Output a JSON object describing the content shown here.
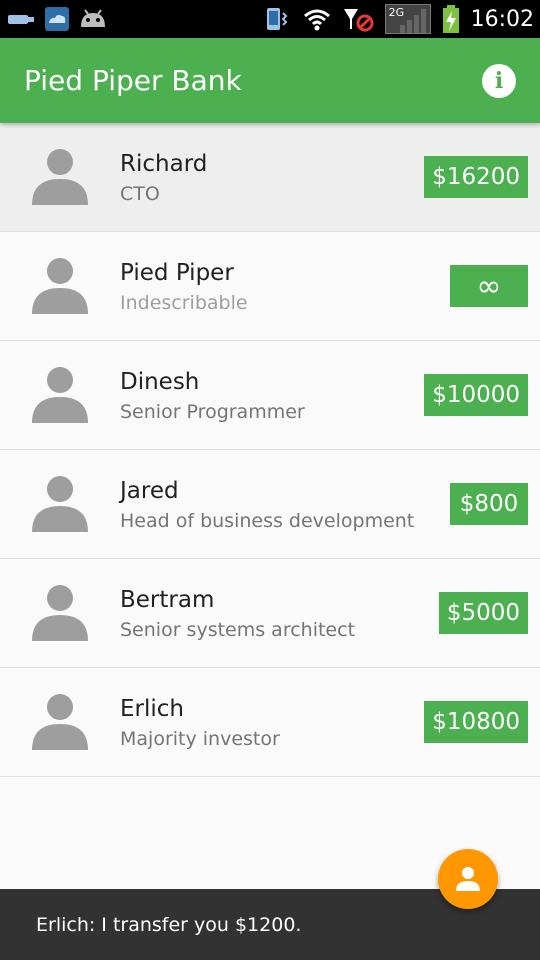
{
  "status_bar": {
    "network_label": "2G",
    "time": "16:02",
    "icons": [
      "usb-icon",
      "cloud-icon",
      "android-icon",
      "vibrate-icon",
      "wifi-icon",
      "no-signal-icon",
      "signal-icon",
      "battery-charging-icon"
    ]
  },
  "app_bar": {
    "title": "Pied Piper Bank",
    "info_icon": "info-icon"
  },
  "accounts": [
    {
      "name": "Richard",
      "role": "CTO",
      "amount": "$16200"
    },
    {
      "name": "Pied Piper",
      "role": "Indescribable",
      "amount": "∞"
    },
    {
      "name": "Dinesh",
      "role": "Senior Programmer",
      "amount": "$10000"
    },
    {
      "name": "Jared",
      "role": "Head of business development",
      "amount": "$800"
    },
    {
      "name": "Bertram",
      "role": "Senior systems architect",
      "amount": "$5000"
    },
    {
      "name": "Erlich",
      "role": "Majority investor",
      "amount": "$10800"
    }
  ],
  "snackbar": {
    "message": "Erlich: I transfer you $1200."
  },
  "fab": {
    "icon": "person-icon"
  },
  "colors": {
    "primary": "#4caf50",
    "accent": "#ff9800",
    "snackbar": "#323232"
  }
}
